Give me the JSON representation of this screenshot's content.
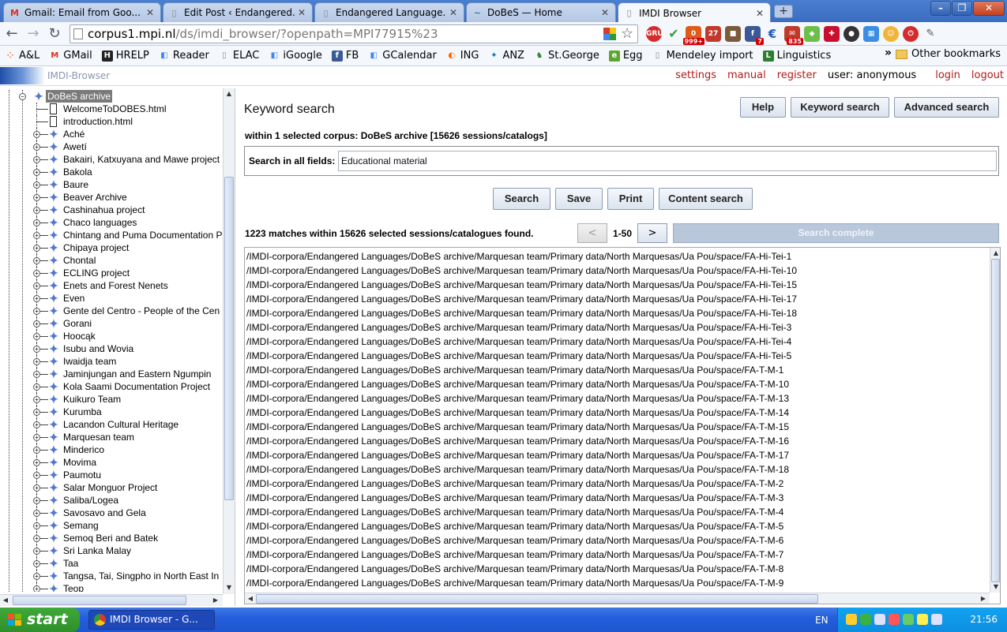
{
  "tabs": [
    {
      "title": "Gmail: Email from Goo...",
      "icon": "gmail-icon",
      "color": "#d93025",
      "glyph": "M"
    },
    {
      "title": "Edit Post ‹ Endangered...",
      "icon": "page-icon",
      "color": "#888888",
      "glyph": "▯"
    },
    {
      "title": "Endangered Language...",
      "icon": "page-icon",
      "color": "#888888",
      "glyph": "▯"
    },
    {
      "title": "DoBeS — Home",
      "icon": "dobes-icon",
      "color": "#3a7a9a",
      "glyph": "~"
    },
    {
      "title": "IMDI Browser",
      "icon": "page-icon",
      "color": "#888888",
      "glyph": "▯"
    }
  ],
  "window_controls": {
    "minimize": "–",
    "restore": "❐",
    "close": "✕"
  },
  "address": {
    "host": "corpus1.mpi.nl",
    "path": "/ds/imdi_browser/?openpath=MPI77915%23"
  },
  "extensions": [
    {
      "name": "gru-ext-icon",
      "color": "#d42c2c",
      "label": "GRU",
      "badge": ""
    },
    {
      "name": "check-ext-icon",
      "color": "#3f9b3f",
      "label": "✔",
      "badge": ""
    },
    {
      "name": "counter-ext-icon",
      "color": "#e05a1a",
      "label": "0",
      "badge": "999+"
    },
    {
      "name": "calendar-ext-icon",
      "color": "#c0392b",
      "label": "27",
      "badge": "27"
    },
    {
      "name": "box-ext-icon",
      "color": "#7a5a3a",
      "label": "■",
      "badge": ""
    },
    {
      "name": "facebook-ext-icon",
      "color": "#3b5998",
      "label": "f",
      "badge": "7"
    },
    {
      "name": "euro-ext-icon",
      "color": "#1d5bbf",
      "label": "€",
      "badge": ""
    },
    {
      "name": "mail-ext-icon",
      "color": "#c0392b",
      "label": "✉",
      "badge": "835"
    },
    {
      "name": "feedly-ext-icon",
      "color": "#6cc04a",
      "label": "◆",
      "badge": ""
    },
    {
      "name": "plus-ext-icon",
      "color": "#c8102e",
      "label": "✚",
      "badge": ""
    },
    {
      "name": "circle-ext-icon",
      "color": "#333333",
      "label": "●",
      "badge": ""
    },
    {
      "name": "grid-ext-icon",
      "color": "#3a8ee6",
      "label": "▦",
      "badge": ""
    },
    {
      "name": "face-ext-icon",
      "color": "#f0b43a",
      "label": "☺",
      "badge": ""
    },
    {
      "name": "power-ext-icon",
      "color": "#d42c2c",
      "label": "⏻",
      "badge": ""
    },
    {
      "name": "wrench-icon",
      "color": "#555555",
      "label": "🔧",
      "badge": ""
    }
  ],
  "bookmarks": [
    {
      "label": "A&L",
      "icon": "al-bookmark-icon",
      "color": "#e07020",
      "glyph": "⁘"
    },
    {
      "label": "GMail",
      "icon": "gmail-icon",
      "color": "#d93025",
      "glyph": "M"
    },
    {
      "label": "HRELP",
      "icon": "hrelp-icon",
      "color": "#222222",
      "glyph": "H"
    },
    {
      "label": "Reader",
      "icon": "google-reader-icon",
      "color": "#4285f4",
      "glyph": "◧"
    },
    {
      "label": "ELAC",
      "icon": "page-icon",
      "color": "#888888",
      "glyph": "▯"
    },
    {
      "label": "iGoogle",
      "icon": "igoogle-icon",
      "color": "#4285f4",
      "glyph": "◧"
    },
    {
      "label": "FB",
      "icon": "facebook-icon",
      "color": "#3b5998",
      "glyph": "f"
    },
    {
      "label": "GCalendar",
      "icon": "gcalendar-icon",
      "color": "#4285f4",
      "glyph": "◧"
    },
    {
      "label": "ING",
      "icon": "ing-icon",
      "color": "#ff6200",
      "glyph": "◐"
    },
    {
      "label": "ANZ",
      "icon": "anz-icon",
      "color": "#0072ac",
      "glyph": "✦"
    },
    {
      "label": "St.George",
      "icon": "stgeorge-icon",
      "color": "#2e7d32",
      "glyph": "♞"
    },
    {
      "label": "Egg",
      "icon": "egg-icon",
      "color": "#5da532",
      "glyph": "e"
    },
    {
      "label": "Mendeley import",
      "icon": "page-icon",
      "color": "#888888",
      "glyph": "▯"
    },
    {
      "label": "Linguistics",
      "icon": "linguistics-icon",
      "color": "#2e7d32",
      "glyph": "L"
    }
  ],
  "bookmarks_more": "»",
  "other_bookmarks": "Other bookmarks",
  "app": {
    "name": "IMDI-Browser",
    "links": [
      "settings",
      "manual",
      "register"
    ],
    "user": "user: anonymous",
    "right_links": [
      "login",
      "logout"
    ]
  },
  "tree": {
    "root": "DoBeS archive",
    "files": [
      "WelcomeToDOBES.html",
      "introduction.html"
    ],
    "items": [
      "Aché",
      "Awetí",
      "Bakairi, Katxuyana and Mawe project",
      "Bakola",
      "Baure",
      "Beaver Archive",
      "Cashinahua project",
      "Chaco languages",
      "Chintang and Puma Documentation P",
      "Chipaya project",
      "Chontal",
      "ECLING project",
      "Enets and Forest Nenets",
      "Even",
      "Gente del Centro - People of the Cen",
      "Gorani",
      "Hoocąk",
      "Isubu and Wovia",
      "Iwaidja team",
      "Jaminjungan and Eastern Ngumpin",
      "Kola Saami Documentation Project",
      "Kuikuro Team",
      "Kurumba",
      "Lacandon Cultural Heritage",
      "Marquesan team",
      "Minderico",
      "Movima",
      "Paumotu",
      "Salar Monguor Project",
      "Saliba/Logea",
      "Savosavo and Gela",
      "Semang",
      "Semoq Beri and Batek",
      "Sri Lanka Malay",
      "Taa",
      "Tangsa, Tai, Singpho in North East In",
      "Teop"
    ]
  },
  "search": {
    "title": "Keyword search",
    "buttons": {
      "help": "Help",
      "keyword": "Keyword search",
      "advanced": "Advanced search"
    },
    "scope": "within 1 selected corpus: DoBeS archive [15626 sessions/catalogs]",
    "field_label": "Search in all fields:",
    "field_value": "Educational material",
    "actions": {
      "search": "Search",
      "save": "Save",
      "print": "Print",
      "content": "Content search"
    },
    "match_summary": "1223 matches within 15626 selected sessions/catalogues found.",
    "prev": "<",
    "range": "1-50",
    "next": ">",
    "status": "Search complete"
  },
  "results": [
    "/IMDI-corpora/Endangered Languages/DoBeS archive/Marquesan team/Primary data/North Marquesas/Ua Pou/space/FA-Hi-Tei-1",
    "/IMDI-corpora/Endangered Languages/DoBeS archive/Marquesan team/Primary data/North Marquesas/Ua Pou/space/FA-Hi-Tei-10",
    "/IMDI-corpora/Endangered Languages/DoBeS archive/Marquesan team/Primary data/North Marquesas/Ua Pou/space/FA-Hi-Tei-15",
    "/IMDI-corpora/Endangered Languages/DoBeS archive/Marquesan team/Primary data/North Marquesas/Ua Pou/space/FA-Hi-Tei-17",
    "/IMDI-corpora/Endangered Languages/DoBeS archive/Marquesan team/Primary data/North Marquesas/Ua Pou/space/FA-Hi-Tei-18",
    "/IMDI-corpora/Endangered Languages/DoBeS archive/Marquesan team/Primary data/North Marquesas/Ua Pou/space/FA-Hi-Tei-3",
    "/IMDI-corpora/Endangered Languages/DoBeS archive/Marquesan team/Primary data/North Marquesas/Ua Pou/space/FA-Hi-Tei-4",
    "/IMDI-corpora/Endangered Languages/DoBeS archive/Marquesan team/Primary data/North Marquesas/Ua Pou/space/FA-Hi-Tei-5",
    "/IMDI-corpora/Endangered Languages/DoBeS archive/Marquesan team/Primary data/North Marquesas/Ua Pou/space/FA-T-M-1",
    "/IMDI-corpora/Endangered Languages/DoBeS archive/Marquesan team/Primary data/North Marquesas/Ua Pou/space/FA-T-M-10",
    "/IMDI-corpora/Endangered Languages/DoBeS archive/Marquesan team/Primary data/North Marquesas/Ua Pou/space/FA-T-M-13",
    "/IMDI-corpora/Endangered Languages/DoBeS archive/Marquesan team/Primary data/North Marquesas/Ua Pou/space/FA-T-M-14",
    "/IMDI-corpora/Endangered Languages/DoBeS archive/Marquesan team/Primary data/North Marquesas/Ua Pou/space/FA-T-M-15",
    "/IMDI-corpora/Endangered Languages/DoBeS archive/Marquesan team/Primary data/North Marquesas/Ua Pou/space/FA-T-M-16",
    "/IMDI-corpora/Endangered Languages/DoBeS archive/Marquesan team/Primary data/North Marquesas/Ua Pou/space/FA-T-M-17",
    "/IMDI-corpora/Endangered Languages/DoBeS archive/Marquesan team/Primary data/North Marquesas/Ua Pou/space/FA-T-M-18",
    "/IMDI-corpora/Endangered Languages/DoBeS archive/Marquesan team/Primary data/North Marquesas/Ua Pou/space/FA-T-M-2",
    "/IMDI-corpora/Endangered Languages/DoBeS archive/Marquesan team/Primary data/North Marquesas/Ua Pou/space/FA-T-M-3",
    "/IMDI-corpora/Endangered Languages/DoBeS archive/Marquesan team/Primary data/North Marquesas/Ua Pou/space/FA-T-M-4",
    "/IMDI-corpora/Endangered Languages/DoBeS archive/Marquesan team/Primary data/North Marquesas/Ua Pou/space/FA-T-M-5",
    "/IMDI-corpora/Endangered Languages/DoBeS archive/Marquesan team/Primary data/North Marquesas/Ua Pou/space/FA-T-M-6",
    "/IMDI-corpora/Endangered Languages/DoBeS archive/Marquesan team/Primary data/North Marquesas/Ua Pou/space/FA-T-M-7",
    "/IMDI-corpora/Endangered Languages/DoBeS archive/Marquesan team/Primary data/North Marquesas/Ua Pou/space/FA-T-M-8",
    "/IMDI-corpora/Endangered Languages/DoBeS archive/Marquesan team/Primary data/North Marquesas/Ua Pou/space/FA-T-M-9"
  ],
  "taskbar": {
    "start": "start",
    "window": "IMDI Browser - G...",
    "language": "EN",
    "clock": "21:56"
  },
  "tray_colors": [
    "#ffcc33",
    "#3cb043",
    "#e0e0ff",
    "#ff5555",
    "#66cc66",
    "#ffee55",
    "#e0e0ff"
  ]
}
